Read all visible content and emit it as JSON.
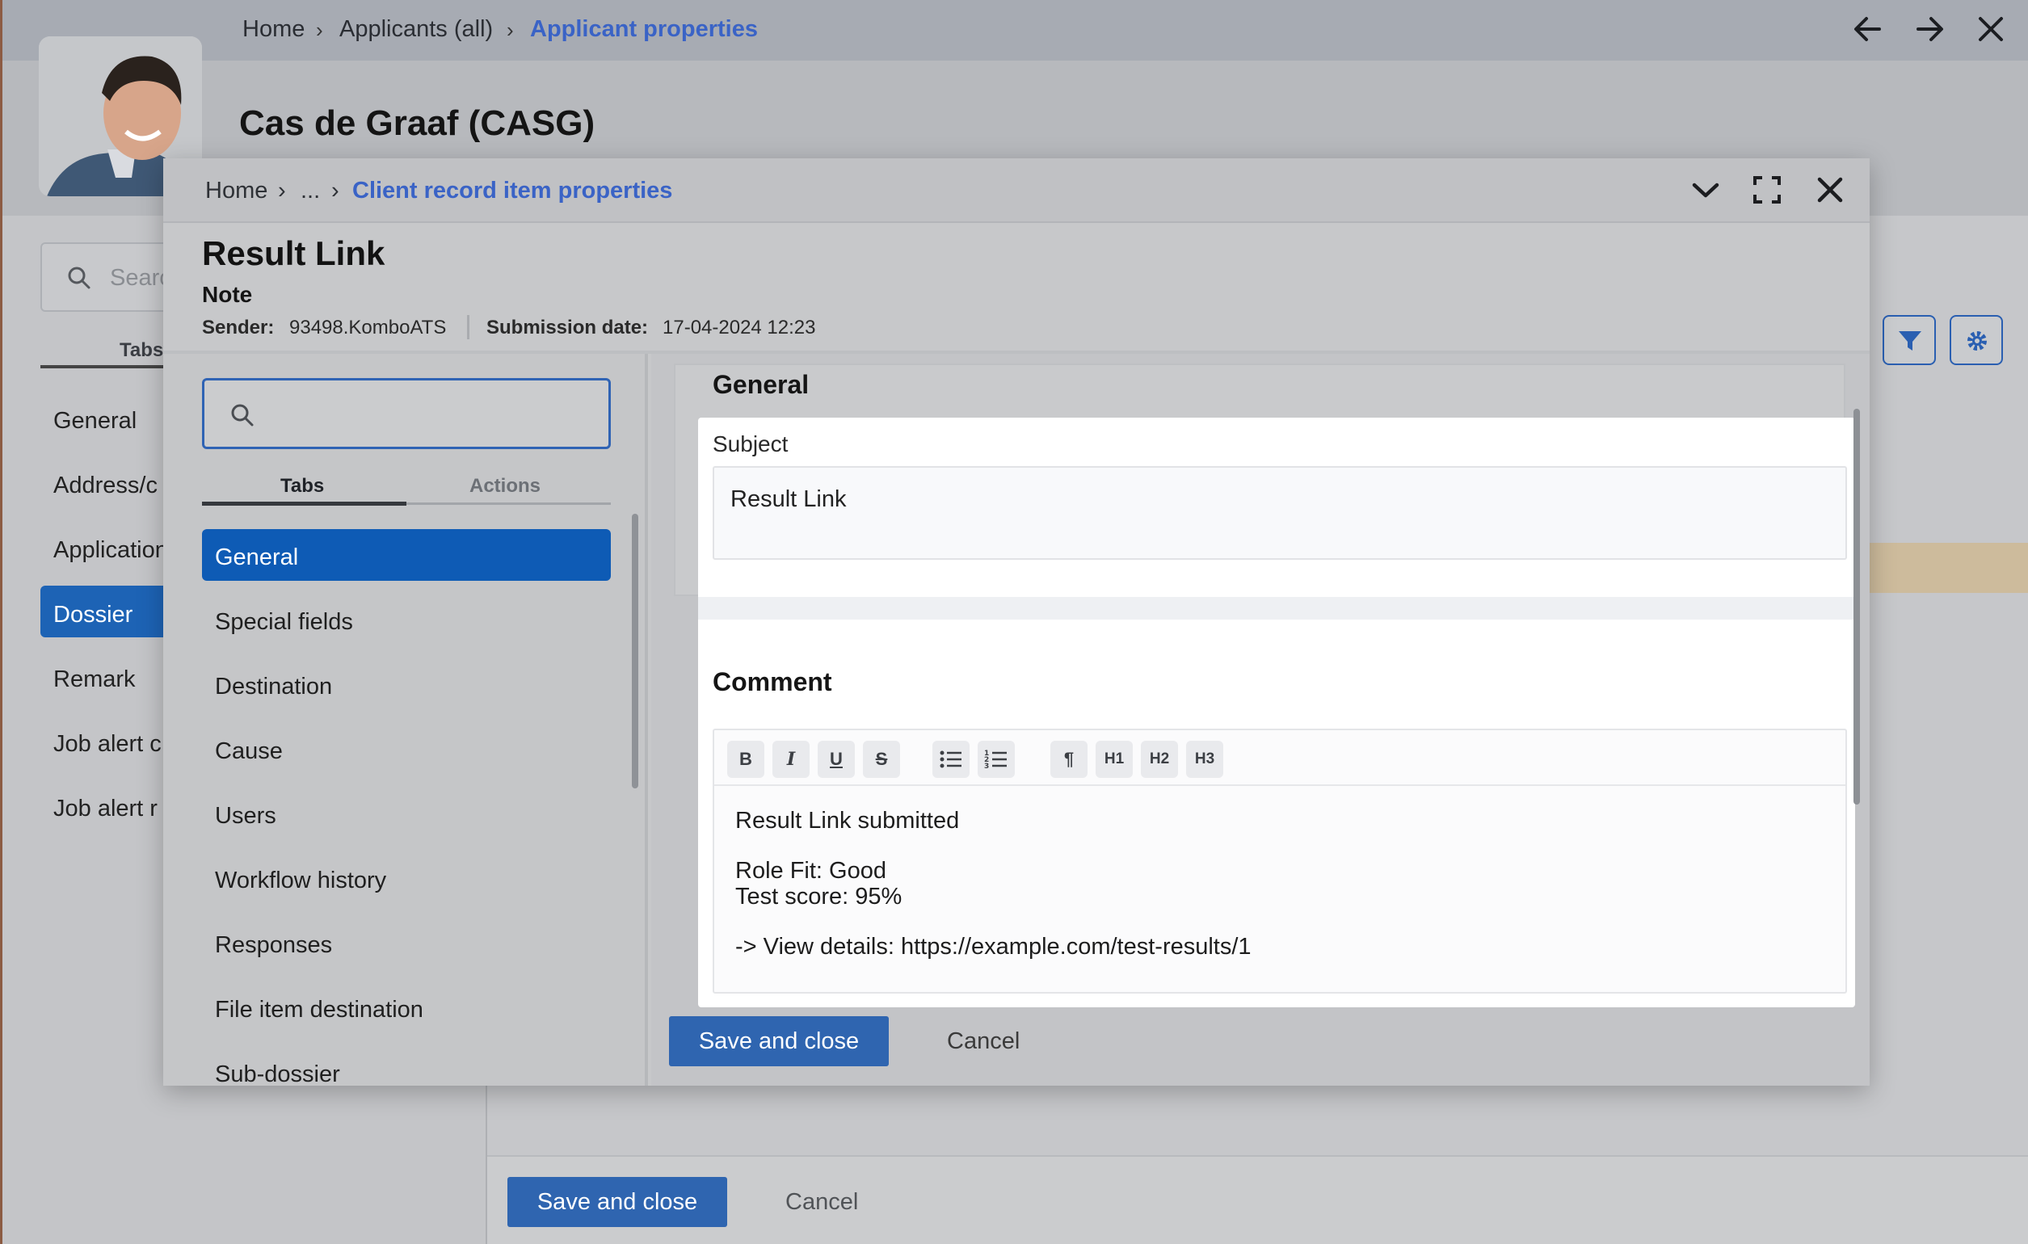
{
  "background": {
    "breadcrumbs": [
      "Home",
      "Applicants (all)",
      "Applicant properties"
    ],
    "applicant_name": "Cas de Graaf (CASG)",
    "search_placeholder": "Search",
    "tabs_label": "Tabs",
    "nav_items": [
      "General",
      "Address/c",
      "Application",
      "Dossier",
      "Remark",
      "Job alert c",
      "Job alert r"
    ],
    "active_nav": "Dossier",
    "footer": {
      "save_label": "Save and close",
      "cancel_label": "Cancel"
    }
  },
  "dialog": {
    "breadcrumbs": [
      "Home",
      "...",
      "Client record item properties"
    ],
    "title": "Result Link",
    "type": "Note",
    "sender_label": "Sender:",
    "sender_value": "93498.KomboATS",
    "submission_label": "Submission date:",
    "submission_value": "17-04-2024 12:23",
    "tabs": {
      "tabs_label": "Tabs",
      "actions_label": "Actions"
    },
    "nav_items": [
      "General",
      "Special fields",
      "Destination",
      "Cause",
      "Users",
      "Workflow history",
      "Responses",
      "File item destination",
      "Sub-dossier"
    ],
    "active_nav": "General",
    "section_general": "General",
    "subject_label": "Subject",
    "subject_value": "Result Link",
    "section_comment": "Comment",
    "editor_toolbar": {
      "bold": "B",
      "italic": "I",
      "underline": "U",
      "strike": "S",
      "paragraph": "¶",
      "h1": "H1",
      "h2": "H2",
      "h3": "H3"
    },
    "comment_lines": [
      "Result Link submitted",
      "Role Fit: Good",
      "Test score: 95%",
      "-> View details: https://example.com/test-results/1"
    ],
    "footer": {
      "save_label": "Save and close",
      "cancel_label": "Cancel"
    }
  },
  "colors": {
    "accent": "#0e5bb5",
    "link": "#3a63c6",
    "primary_button": "#2f65b0"
  }
}
